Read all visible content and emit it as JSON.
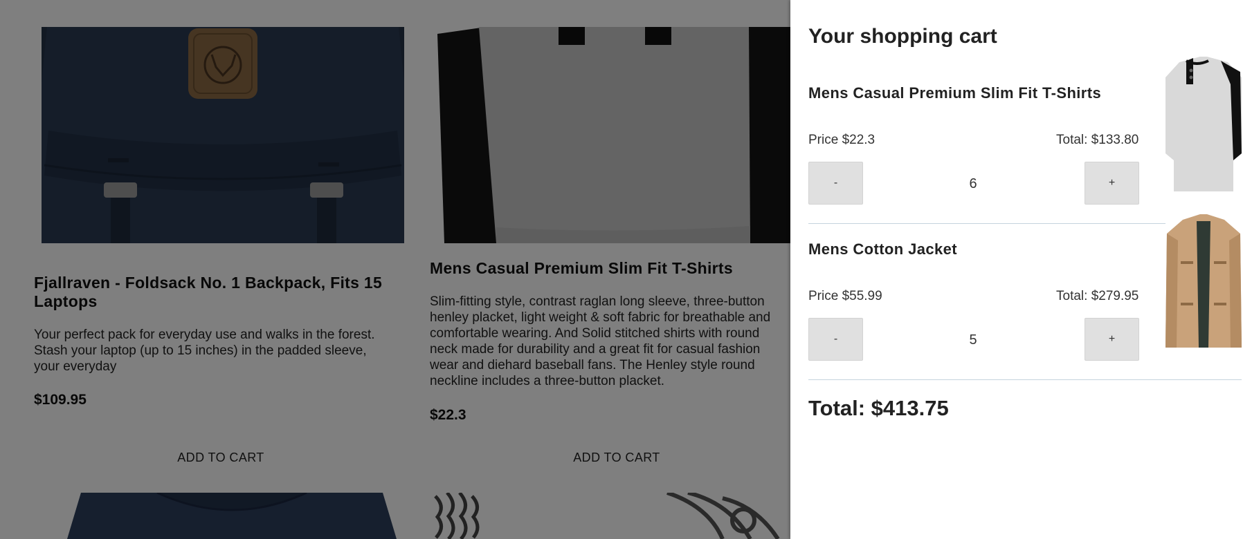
{
  "products": [
    {
      "title": "Fjallraven - Foldsack No. 1 Backpack, Fits 15 Laptops",
      "description": "Your perfect pack for everyday use and walks in the forest. Stash your laptop (up to 15 inches) in the padded sleeve, your everyday",
      "price": "$109.95",
      "button": "ADD TO CART"
    },
    {
      "title": "Mens Casual Premium Slim Fit T-Shirts",
      "description": "Slim-fitting style, contrast raglan long sleeve, three-button henley placket, light weight & soft fabric for breathable and comfortable wearing. And Solid stitched shirts with round neck made for durability and a great fit for casual fashion wear and diehard baseball fans. The Henley style round neckline includes a three-button placket.",
      "price": "$22.3",
      "button": "ADD TO CART"
    }
  ],
  "cart": {
    "title": "Your shopping cart",
    "items": [
      {
        "name": "Mens Casual Premium Slim Fit T-Shirts",
        "price": "Price $22.3",
        "total": "Total: $133.80",
        "quantity": "6",
        "decrement": "-",
        "increment": "+"
      },
      {
        "name": "Mens Cotton Jacket",
        "price": "Price $55.99",
        "total": "Total: $279.95",
        "quantity": "5",
        "decrement": "-",
        "increment": "+"
      }
    ],
    "grand_total": "Total: $413.75"
  }
}
